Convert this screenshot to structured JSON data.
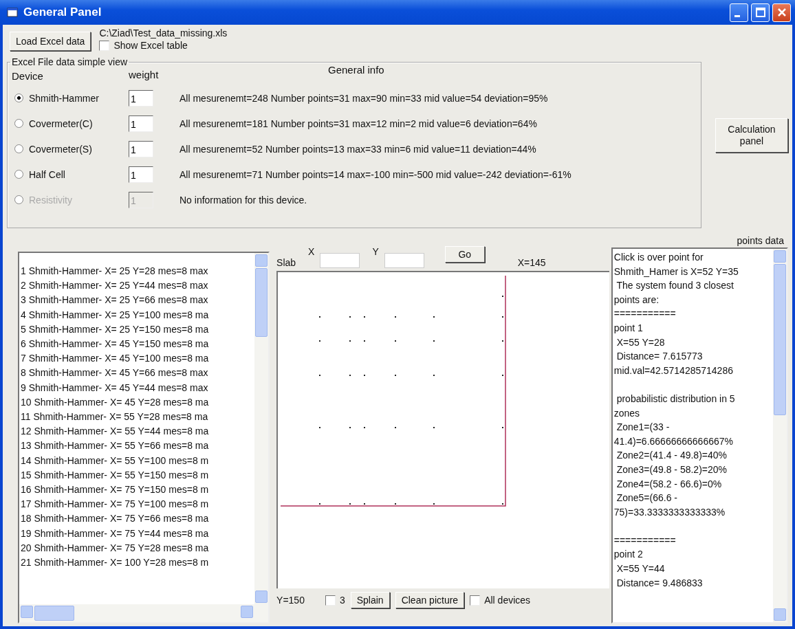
{
  "window": {
    "title": "General Panel"
  },
  "load_button": "Load Excel data",
  "file_path": "C:\\Ziad\\Test_data_missing.xls",
  "show_table": {
    "label": "Show Excel table",
    "checked": false
  },
  "group": {
    "title": "Excel File data simple view",
    "device_header": "Device",
    "weight_header": "weight",
    "info_header": "General info",
    "devices": [
      {
        "name": "Shmith-Hammer",
        "selected": true,
        "disabled": false,
        "weight": "1",
        "info": "All mesurenemt=248 Number points=31 max=90 min=33 mid value=54 deviation=95%"
      },
      {
        "name": "Covermeter(C)",
        "selected": false,
        "disabled": false,
        "weight": "1",
        "info": "All mesurenemt=181 Number points=31 max=12 min=2 mid value=6 deviation=64%"
      },
      {
        "name": "Covermeter(S)",
        "selected": false,
        "disabled": false,
        "weight": "1",
        "info": "All mesurenemt=52 Number points=13 max=33 min=6 mid value=11 deviation=44%"
      },
      {
        "name": "Half Cell",
        "selected": false,
        "disabled": false,
        "weight": "1",
        "info": "All mesurenemt=71 Number points=14 max=-100 min=-500 mid value=-242 deviation=-61%"
      },
      {
        "name": "Resistivity",
        "selected": false,
        "disabled": true,
        "weight": "1",
        "info": "No information for this device."
      }
    ]
  },
  "calc_button": "Calculation panel",
  "points_label": "points data",
  "measurements": [
    "1 Shmith-Hammer- X= 25 Y=28 mes=8 max",
    "2 Shmith-Hammer- X= 25 Y=44 mes=8 max",
    "3 Shmith-Hammer- X= 25 Y=66 mes=8 max",
    "4 Shmith-Hammer- X= 25 Y=100 mes=8 ma",
    "5 Shmith-Hammer- X= 25 Y=150 mes=8 ma",
    "6 Shmith-Hammer- X= 45 Y=150 mes=8 ma",
    "7 Shmith-Hammer- X= 45 Y=100 mes=8 ma",
    "8 Shmith-Hammer- X= 45 Y=66 mes=8 max",
    "9 Shmith-Hammer- X= 45 Y=44 mes=8 max",
    "10 Shmith-Hammer- X= 45 Y=28 mes=8 ma",
    "11 Shmith-Hammer- X= 55 Y=28 mes=8 ma",
    "12 Shmith-Hammer- X= 55 Y=44 mes=8 ma",
    "13 Shmith-Hammer- X= 55 Y=66 mes=8 ma",
    "14 Shmith-Hammer- X= 55 Y=100 mes=8 m",
    "15 Shmith-Hammer- X= 55 Y=150 mes=8 m",
    "16 Shmith-Hammer- X= 75 Y=150 mes=8 m",
    "17 Shmith-Hammer- X= 75 Y=100 mes=8 m",
    "18 Shmith-Hammer- X= 75 Y=66 mes=8 ma",
    "19 Shmith-Hammer- X= 75 Y=44 mes=8 ma",
    "20 Shmith-Hammer- X= 75 Y=28 mes=8 ma",
    "21 Shmith-Hammer- X= 100 Y=28 mes=8 m"
  ],
  "slab": {
    "label": "Slab",
    "x_label": "X",
    "y_label": "Y",
    "go_button": "Go",
    "x_reading": "X=145",
    "y_reading": "Y=150",
    "three": {
      "label": "3",
      "checked": false
    },
    "splain_button": "Splain",
    "clean_button": "Clean picture",
    "all_devices": {
      "label": "All devices",
      "checked": false
    }
  },
  "points_data": [
    [
      "Click is over point for",
      "Shmith_Hamer is X=52 Y=35",
      " The system found 3 closest",
      "points are:",
      "===========",
      "point 1",
      " X=55 Y=28",
      " Distance= 7.615773",
      "mid.val=42.5714285714286"
    ],
    [
      " probabilistic distribution in 5",
      "zones",
      " Zone1=(33 -",
      "41.4)=6.66666666666667%",
      " Zone2=(41.4 - 49.8)=40%",
      " Zone3=(49.8 - 58.2)=20%",
      " Zone4=(58.2 - 66.6)=0%",
      " Zone5=(66.6 -",
      "75)=33.3333333333333%"
    ],
    [
      "===========",
      "point 2",
      " X=55 Y=44",
      " Distance= 9.486833"
    ]
  ]
}
